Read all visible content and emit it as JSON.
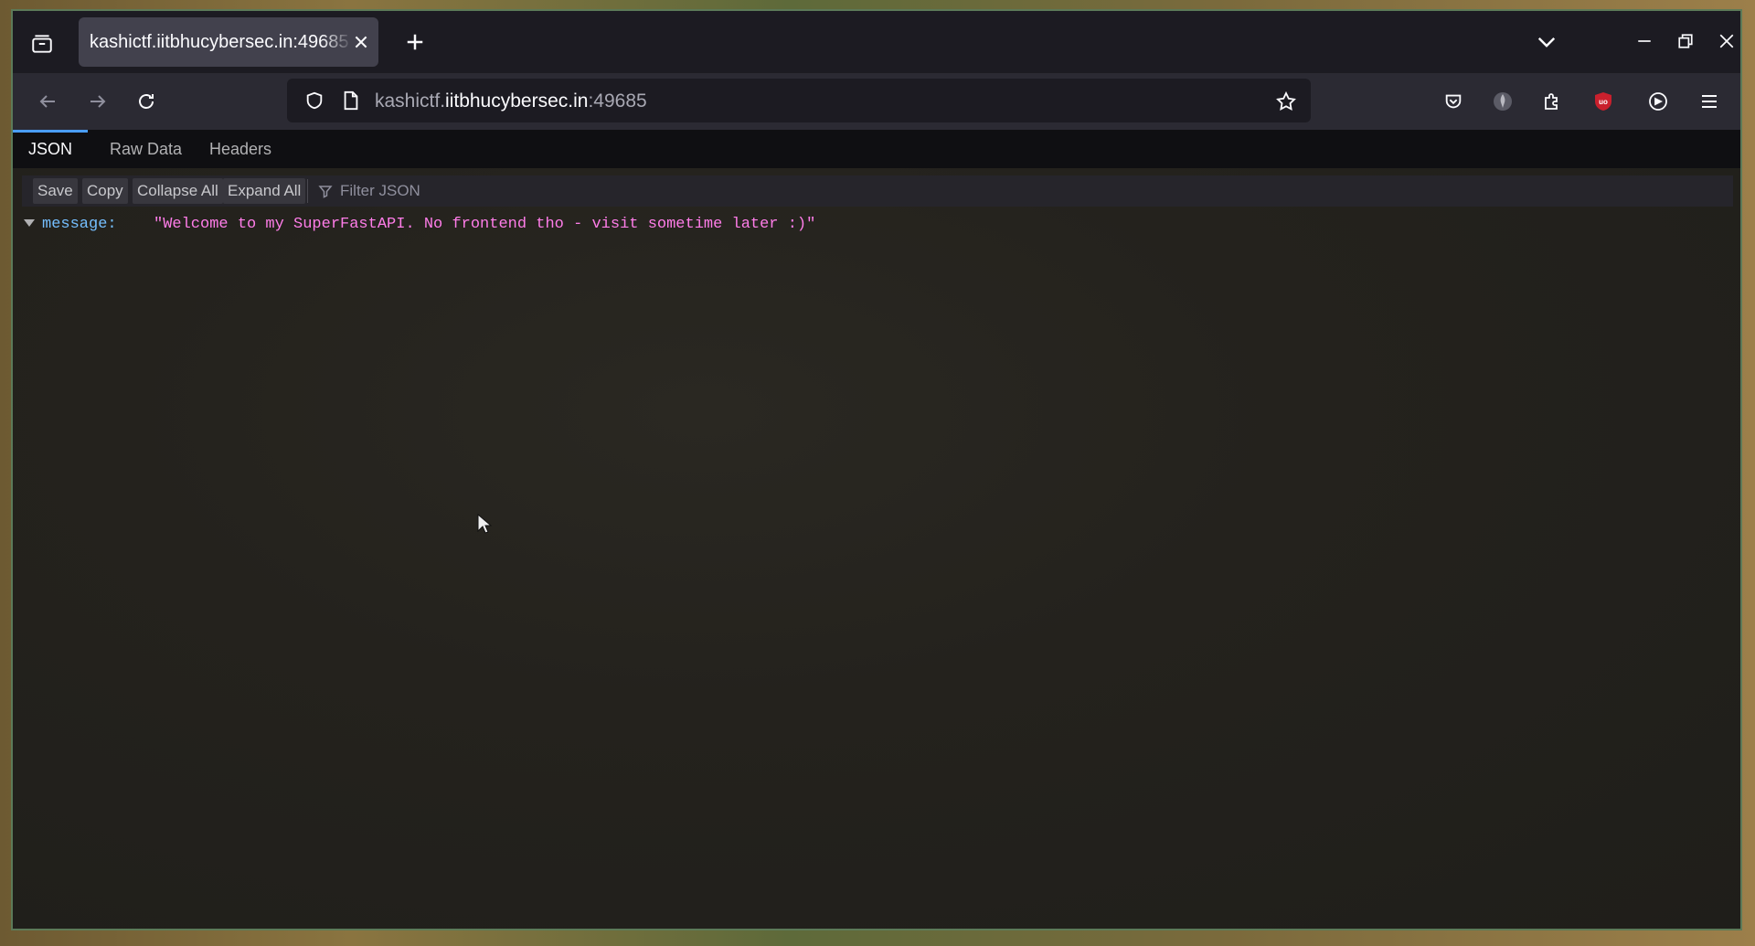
{
  "browser": {
    "tab": {
      "title": "kashictf.iitbhucybersec.in:49685"
    },
    "url": {
      "prefix": "kashictf.",
      "host": "iitbhucybersec.in",
      "port": ":49685"
    }
  },
  "viewer": {
    "tabs": [
      {
        "label": "JSON",
        "active": true
      },
      {
        "label": "Raw Data",
        "active": false
      },
      {
        "label": "Headers",
        "active": false
      }
    ],
    "toolbar": {
      "save_label": "Save",
      "copy_label": "Copy",
      "collapse_label": "Collapse All",
      "expand_label": "Expand All",
      "filter_placeholder": "Filter JSON"
    },
    "json": {
      "key": "message:",
      "value": "\"Welcome to my SuperFastAPI. No frontend tho - visit sometime later :)\""
    }
  },
  "colors": {
    "accent": "#4a9eff",
    "json_key": "#75bfff",
    "json_string": "#ff7de9",
    "ublock_red": "#c9202d"
  },
  "icons": [
    "tab-list-icon",
    "close-icon",
    "plus-icon",
    "chevron-down-icon",
    "minimize-icon",
    "restore-icon",
    "back-arrow-icon",
    "forward-arrow-icon",
    "reload-icon",
    "shield-icon",
    "page-icon",
    "star-icon",
    "pocket-icon",
    "extension-avatar-icon",
    "puzzle-icon",
    "ublock-icon",
    "extension-circle-icon",
    "hamburger-menu-icon",
    "filter-icon",
    "mouse-cursor-icon"
  ]
}
